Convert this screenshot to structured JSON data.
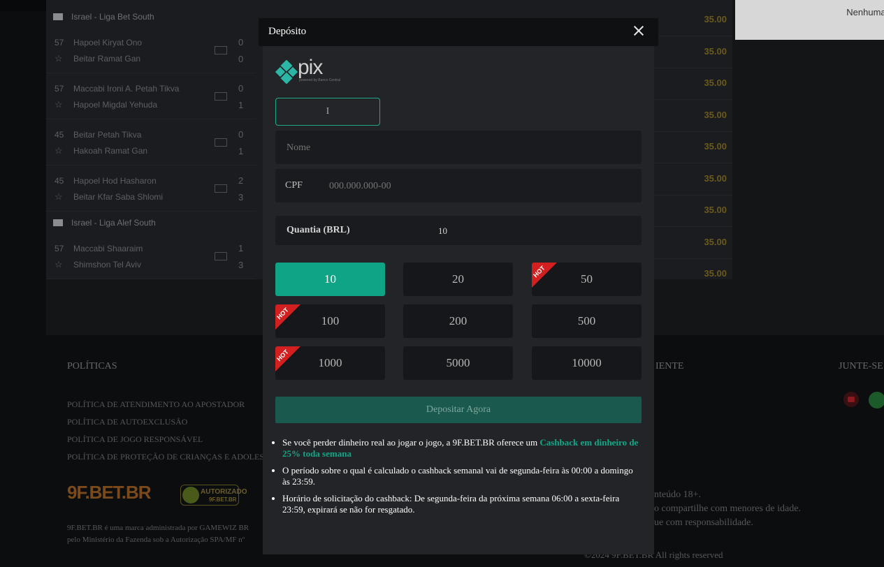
{
  "background": {
    "leagues": [
      {
        "name": "Israel - Liga Bet South"
      },
      {
        "name": "Israel - Liga Alef South"
      }
    ],
    "matches": [
      {
        "minute": "57",
        "team1": "Hapoel Kiryat Ono",
        "team2": "Beitar Ramat Gan",
        "score1": "0",
        "score2": "0"
      },
      {
        "minute": "57",
        "team1": "Maccabi Ironi A. Petah Tikva",
        "team2": "Hapoel Migdal Yehuda",
        "score1": "0",
        "score2": "1"
      },
      {
        "minute": "45",
        "team1": "Beitar Petah Tikva",
        "team2": "Hakoah Ramat Gan",
        "score1": "0",
        "score2": "1"
      },
      {
        "minute": "45",
        "team1": "Hapoel Hod Hasharon",
        "team2": "Beitar Kfar Saba Shlomi",
        "score1": "2",
        "score2": "3"
      },
      {
        "minute": "57",
        "team1": "Maccabi Shaaraim",
        "team2": "Shimshon Tel Aviv",
        "score1": "1",
        "score2": "3"
      }
    ],
    "odds": [
      "35.00",
      "35.00",
      "35.00",
      "35.00",
      "35.00",
      "35.00",
      "35.00",
      "35.00",
      "35.00"
    ],
    "right_text": "Nenhuma ca",
    "footer": {
      "policies_title": "POLÍTICAS",
      "policies": [
        "POLÍTICA DE ATENDIMENTO AO APOSTADOR",
        "POLÍTICA DE AUTOEXCLUSÃO",
        "POLÍTICA DE JOGO RESPONSÁVEL",
        "POLÍTICA DE PROTEÇÃO DE CRIANÇAS E ADOLES"
      ],
      "client_title": "IENTE",
      "join_title": "JUNTE-SE",
      "logo": "9F.BET.BR",
      "auth_badge": "AUTORIZADO",
      "auth_badge_sub": "9F.BET.BR",
      "legal_line1": "9F.BET.BR é uma marca administrada por GAMEWIZ BR",
      "legal_line2": "pelo Ministério da Fazenda sob a Autorização SPA/MF nº",
      "age_line1": "nteúdo 18+.",
      "age_line2": "o compartilhe com menores de idade.",
      "age_line3": "ue com responsabilidade.",
      "copyright": "©2024 9F.BET.BR All rights reserved"
    }
  },
  "modal": {
    "title": "Depósito",
    "payment_logo_text": "pix",
    "payment_logo_sub": "powered by Banco Central",
    "method_value": "I",
    "name_placeholder": "Nome",
    "cpf_label": "CPF",
    "cpf_placeholder": "000.000.000-00",
    "amount_label": "Quantia (BRL)",
    "amount_value": "10",
    "amounts": [
      {
        "value": "10",
        "hot": false,
        "selected": true
      },
      {
        "value": "20",
        "hot": false,
        "selected": false
      },
      {
        "value": "50",
        "hot": true,
        "selected": false
      },
      {
        "value": "100",
        "hot": true,
        "selected": false
      },
      {
        "value": "200",
        "hot": false,
        "selected": false
      },
      {
        "value": "500",
        "hot": false,
        "selected": false
      },
      {
        "value": "1000",
        "hot": true,
        "selected": false
      },
      {
        "value": "5000",
        "hot": false,
        "selected": false
      },
      {
        "value": "10000",
        "hot": false,
        "selected": false
      }
    ],
    "hot_label": "HOT",
    "deposit_button": "Depositar Agora",
    "notes": {
      "n1_prefix": "Se você perder dinheiro real ao jogar o jogo, a 9F.BET.BR oferece um ",
      "n1_highlight": "Cashback em dinheiro de 25% toda semana",
      "n2": "O período sobre o qual é calculado o cashback semanal vai de segunda-feira às 00:00 a domingo às 23:59.",
      "n3": "Horário de solicitação do cashback: De segunda-feira da próxima semana 06:00 a sexta-feira 23:59, expirará se não for resgatado."
    }
  },
  "colors": {
    "accent": "#0fa486",
    "hot": "#d21f1f",
    "modal_bg": "#222428"
  }
}
